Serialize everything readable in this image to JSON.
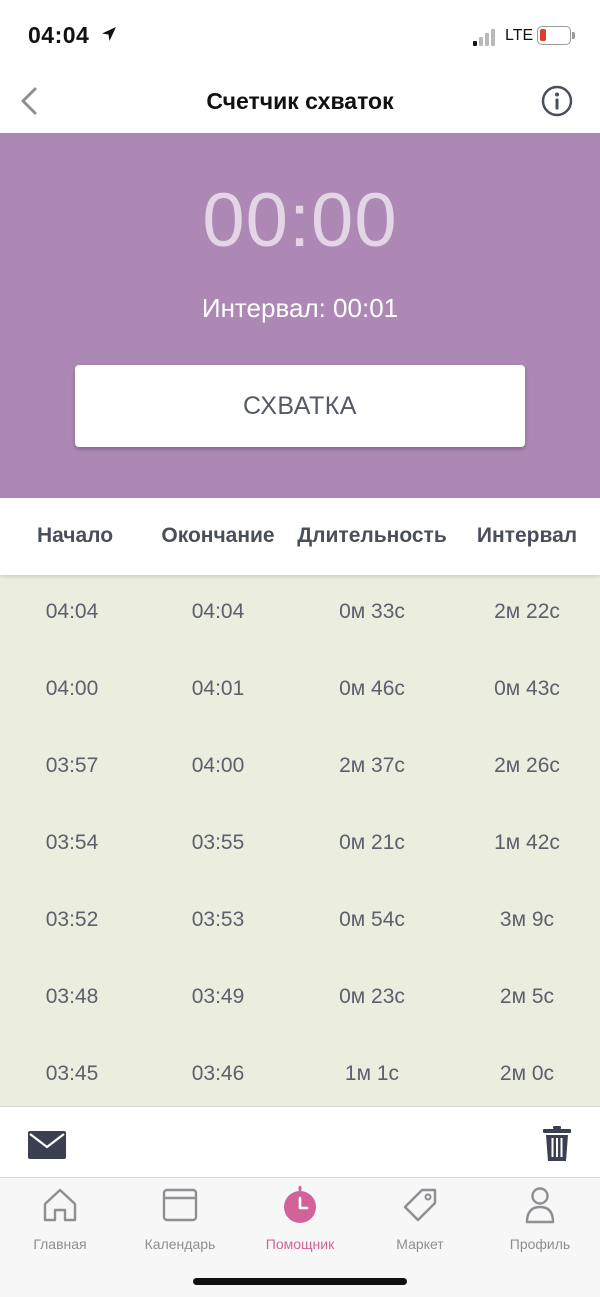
{
  "status_bar": {
    "time": "04:04",
    "network": "LTE"
  },
  "nav": {
    "title": "Счетчик схваток"
  },
  "timer": {
    "elapsed": "00:00",
    "interval_text": "Интервал: 00:01",
    "button_label": "СХВАТКА"
  },
  "table": {
    "columns": [
      "Начало",
      "Окончание",
      "Длительность",
      "Интервал"
    ],
    "rows": [
      [
        "04:04",
        "04:04",
        "0м 33с",
        "2м 22с"
      ],
      [
        "04:00",
        "04:01",
        "0м 46с",
        "0м 43с"
      ],
      [
        "03:57",
        "04:00",
        "2м 37с",
        "2м 26с"
      ],
      [
        "03:54",
        "03:55",
        "0м 21с",
        "1м 42с"
      ],
      [
        "03:52",
        "03:53",
        "0м 54с",
        "3м 9с"
      ],
      [
        "03:48",
        "03:49",
        "0м 23с",
        "2м 5с"
      ],
      [
        "03:45",
        "03:46",
        "1м 1с",
        "2м 0с"
      ]
    ]
  },
  "toolbar": {
    "mail_icon": "mail-icon",
    "trash_icon": "trash-icon"
  },
  "tab_bar": {
    "tabs": [
      {
        "label": "Главная",
        "icon": "home-icon",
        "active": false
      },
      {
        "label": "Календарь",
        "icon": "calendar-icon",
        "active": false
      },
      {
        "label": "Помощник",
        "icon": "assistant-clock-icon",
        "active": true
      },
      {
        "label": "Маркет",
        "icon": "tag-icon",
        "active": false
      },
      {
        "label": "Профиль",
        "icon": "profile-icon",
        "active": false
      }
    ]
  },
  "colors": {
    "panel": "#ad88b5",
    "table_bg": "#ebeedf",
    "accent": "#d2639a",
    "battery_low": "#e23b2e"
  }
}
